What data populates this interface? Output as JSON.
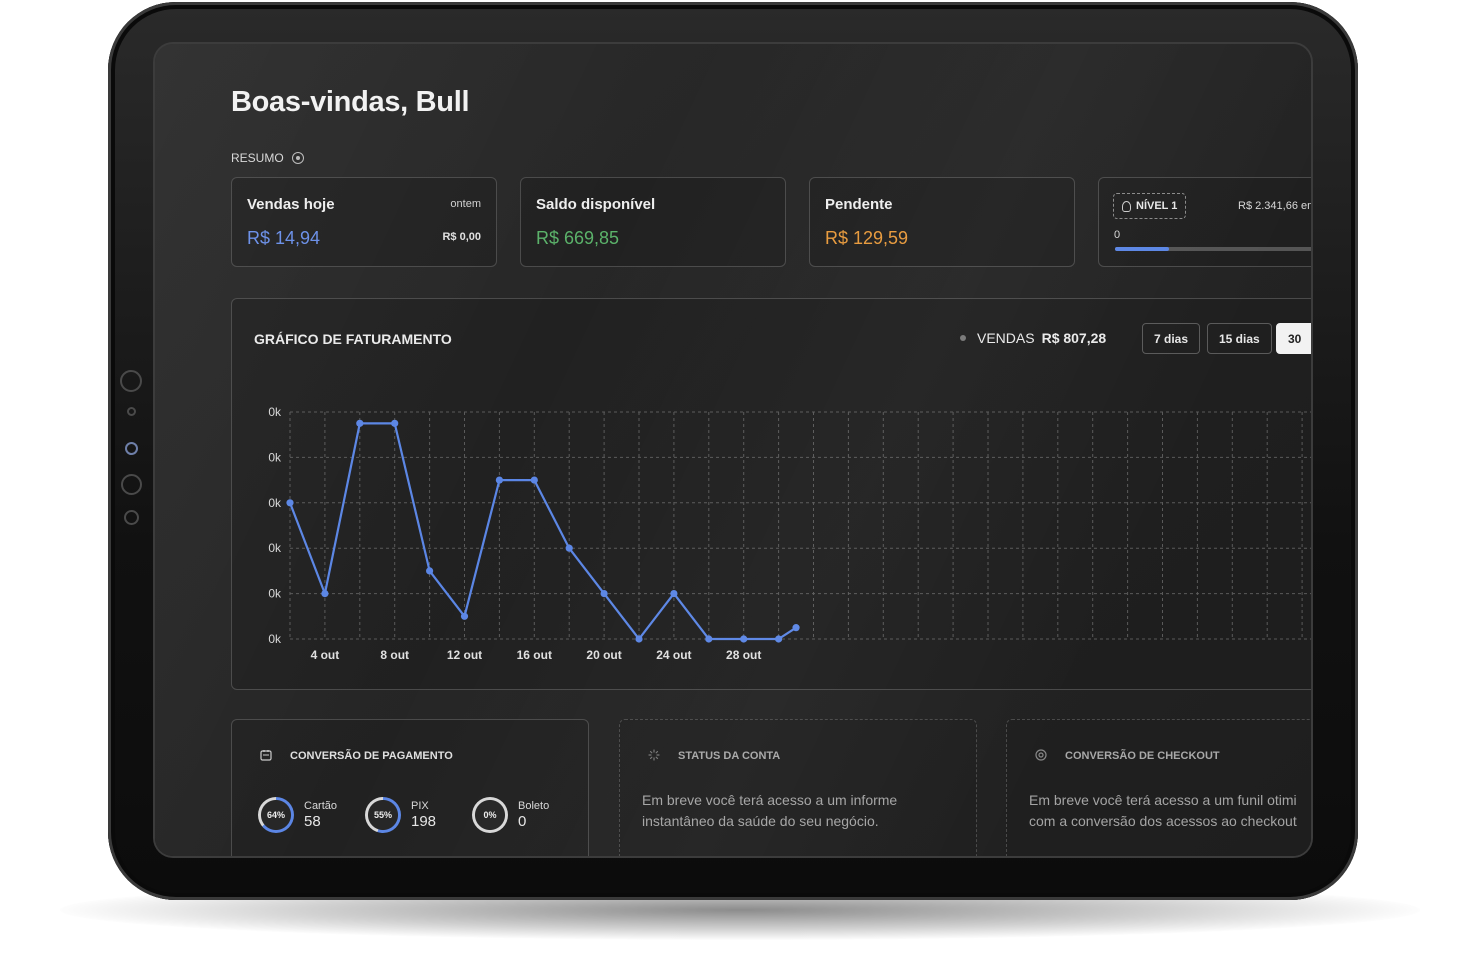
{
  "welcome_title": "Boas-vindas, Bull",
  "summary_label": "RESUMO",
  "cards": {
    "sales_today": {
      "title": "Vendas hoje",
      "value": "R$ 14,94",
      "compare_label": "ontem",
      "compare_value": "R$ 0,00",
      "value_color": "#6a8fe8"
    },
    "available_balance": {
      "title": "Saldo disponível",
      "value": "R$ 669,85",
      "value_color": "#5bb26a"
    },
    "pending": {
      "title": "Pendente",
      "value": "R$ 129,59",
      "value_color": "#e89a3c"
    },
    "level": {
      "badge": "NÍVEL 1",
      "target": "R$ 2.341,66 em",
      "start": "0",
      "progress_fraction": 0.27
    }
  },
  "chart_panel": {
    "title": "GRÁFICO DE FATURAMENTO",
    "sales_label": "VENDAS",
    "sales_total": "R$ 807,28",
    "ranges": [
      "7 dias",
      "15 dias",
      "30"
    ],
    "active_range": 2
  },
  "chart_data": {
    "type": "line",
    "x": [
      2,
      3,
      4,
      5,
      6,
      7,
      8,
      9,
      10,
      11,
      12,
      13,
      14,
      15,
      16,
      17,
      18,
      19,
      20,
      21,
      22,
      23,
      24,
      25,
      26,
      27,
      28,
      29,
      30,
      31
    ],
    "x_tick_labels": [
      "4 out",
      "8 out",
      "12 out",
      "16 out",
      "20 out",
      "24 out",
      "28 out"
    ],
    "x_tick_values": [
      4,
      8,
      12,
      16,
      20,
      24,
      28
    ],
    "y_tick_labels": [
      "0k",
      "0k",
      "0k",
      "0k",
      "0k",
      "0k"
    ],
    "series": [
      {
        "color": "#5b86e5",
        "values": [
          60,
          20,
          95,
          95,
          30,
          10,
          70,
          70,
          40,
          20,
          0,
          20,
          0,
          0,
          0,
          5
        ]
      }
    ],
    "point_days": [
      2,
      4,
      6,
      8,
      10,
      12,
      14,
      16,
      18,
      20,
      22,
      24,
      26,
      28,
      30,
      31
    ],
    "ylim": [
      0,
      100
    ],
    "grid": true,
    "legend": "none"
  },
  "bottom_cards": {
    "payment": {
      "title": "CONVERSÃO DE PAGAMENTO",
      "methods": [
        {
          "pct": "64%",
          "label": "Cartão",
          "count": "58",
          "fraction": 0.64
        },
        {
          "pct": "55%",
          "label": "PIX",
          "count": "198",
          "fraction": 0.55
        },
        {
          "pct": "0%",
          "label": "Boleto",
          "count": "0",
          "fraction": 0
        }
      ]
    },
    "account_status": {
      "title": "STATUS DA CONTA",
      "text": "Em breve você terá acesso a um informe instantâneo da saúde do seu negócio."
    },
    "checkout": {
      "title": "CONVERSÃO DE CHECKOUT",
      "text": "Em breve você terá acesso a um funil otimi com a conversão dos acessos ao checkout"
    }
  }
}
